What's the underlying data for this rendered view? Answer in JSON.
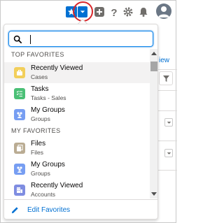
{
  "header": {
    "icons": [
      "favorites-star-icon",
      "chevron-down-icon",
      "add-icon",
      "help-icon",
      "setup-gear-icon",
      "notifications-bell-icon",
      "user-avatar"
    ]
  },
  "background": {
    "link_fragment": "iew"
  },
  "favorites_panel": {
    "search": {
      "value": "",
      "placeholder": ""
    },
    "sections": [
      {
        "label": "TOP FAVORITES",
        "items": [
          {
            "title": "Recently Viewed",
            "subtitle": "Cases",
            "icon": "cases-icon",
            "color": "#f2cf5b"
          },
          {
            "title": "Tasks",
            "subtitle": "Tasks - Sales",
            "icon": "tasks-icon",
            "color": "#4bc076"
          },
          {
            "title": "My Groups",
            "subtitle": "Groups",
            "icon": "groups-icon",
            "color": "#779ef2"
          }
        ]
      },
      {
        "label": "MY FAVORITES",
        "items": [
          {
            "title": "Files",
            "subtitle": "Files",
            "icon": "files-icon",
            "color": "#baac93"
          },
          {
            "title": "My Groups",
            "subtitle": "Groups",
            "icon": "groups-icon",
            "color": "#779ef2"
          },
          {
            "title": "Recently Viewed",
            "subtitle": "Accounts",
            "icon": "accounts-icon",
            "color": "#7f8de1"
          }
        ]
      }
    ],
    "footer": {
      "label": "Edit Favorites",
      "icon": "edit-pencil-icon"
    }
  },
  "colors": {
    "brand": "#0070d2",
    "highlight_circle": "#d8262a",
    "text_default": "#080707",
    "text_weak": "#514f4d"
  }
}
